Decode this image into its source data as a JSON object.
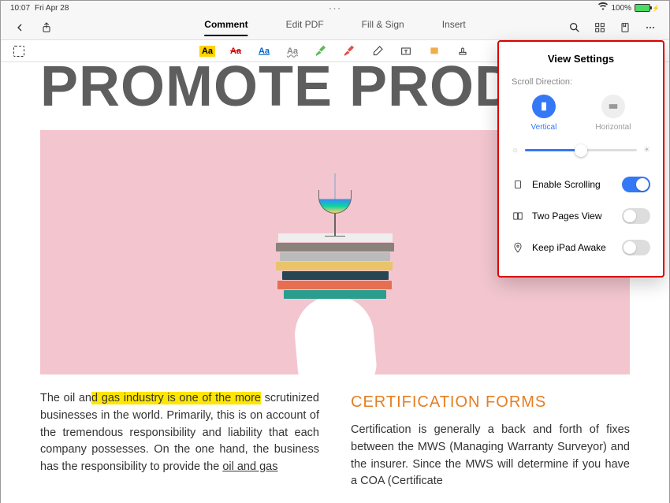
{
  "status": {
    "time": "10:07",
    "date": "Fri Apr 28",
    "battery_pct": "100%"
  },
  "nav": {
    "tabs": [
      "Comment",
      "Edit PDF",
      "Fill & Sign",
      "Insert"
    ],
    "active_tab_index": 0
  },
  "toolbar": {
    "aa_highlight": "Aa",
    "aa_strike": "Aa",
    "aa_underline": "Aa",
    "aa_wavy": "Aa"
  },
  "document": {
    "title": "PROMOTE PRODUCT",
    "col1_before_hl": "The oil an",
    "col1_hl": "d gas industry is one of the more",
    "col1_after_hl": " scrutinized businesses in the world. Primarily, this is on account of the tremendous responsibility and liability that each company possesses. On the one hand, the business has the responsibility to provide the ",
    "col1_ul": "oil and gas",
    "col2_title": "CERTIFICATION FORMS",
    "col2_text": "Certification is generally a back and forth of fixes between the MWS (Managing Warranty Surveyor) and the insurer. Since the MWS will determine if you have a COA (Certificate"
  },
  "panel": {
    "title": "View Settings",
    "scroll_label": "Scroll Direction:",
    "vertical": "Vertical",
    "horizontal": "Horizontal",
    "enable_scrolling": "Enable Scrolling",
    "two_pages": "Two Pages View",
    "keep_awake": "Keep iPad Awake",
    "brightness_value": 50,
    "scroll_direction": "vertical",
    "toggles": {
      "enable_scrolling": true,
      "two_pages": false,
      "keep_awake": false
    }
  }
}
